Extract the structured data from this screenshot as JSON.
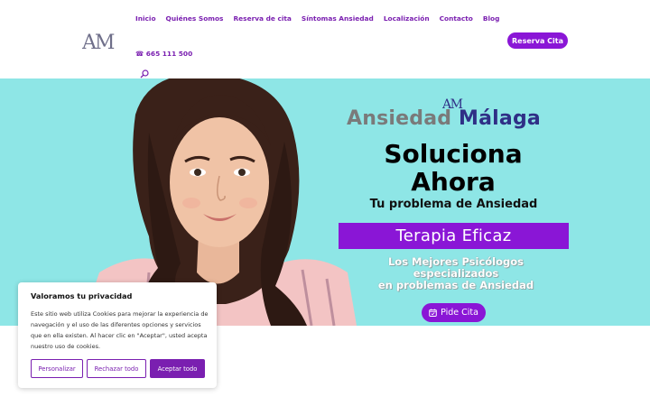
{
  "header": {
    "nav": [
      "Inicio",
      "Quiénes Somos",
      "Reserva de cita",
      "Síntomas Ansiedad",
      "Localización",
      "Contacto",
      "Blog"
    ],
    "phone": "☎ 665 111 500",
    "cta": "Reserva Cita",
    "logo_text": "AM",
    "search_icon": "search-icon"
  },
  "hero": {
    "logo_text": "AM",
    "brand_word1": "Ansiedad",
    "brand_word2": "Málaga",
    "headline": "Soluciona Ahora",
    "subhead": "Tu problema de Ansiedad",
    "banner": "Terapia Eficaz",
    "desc_line1": "Los Mejores Psicólogos",
    "desc_line2": "especializados",
    "desc_line3": "en problemas de Ansiedad",
    "cta": "Pide Cita",
    "background_color": "#8ee6e6"
  },
  "cookie": {
    "title": "Valoramos tu privacidad",
    "text": "Este sitio web utiliza Cookies para mejorar la experiencia de navegación y el uso de las diferentes opciones y servicios que en ella existen. Al hacer clic en \"Aceptar\", usted acepta nuestro uso de cookies.",
    "btn_customize": "Personalizar",
    "btn_reject": "Rechazar todo",
    "btn_accept": "Aceptar todo"
  },
  "colors": {
    "accent": "#8a16d6",
    "nav": "#7a1fb0",
    "brand_dark": "#2f2f86",
    "brand_grey": "#7a7a7a"
  }
}
